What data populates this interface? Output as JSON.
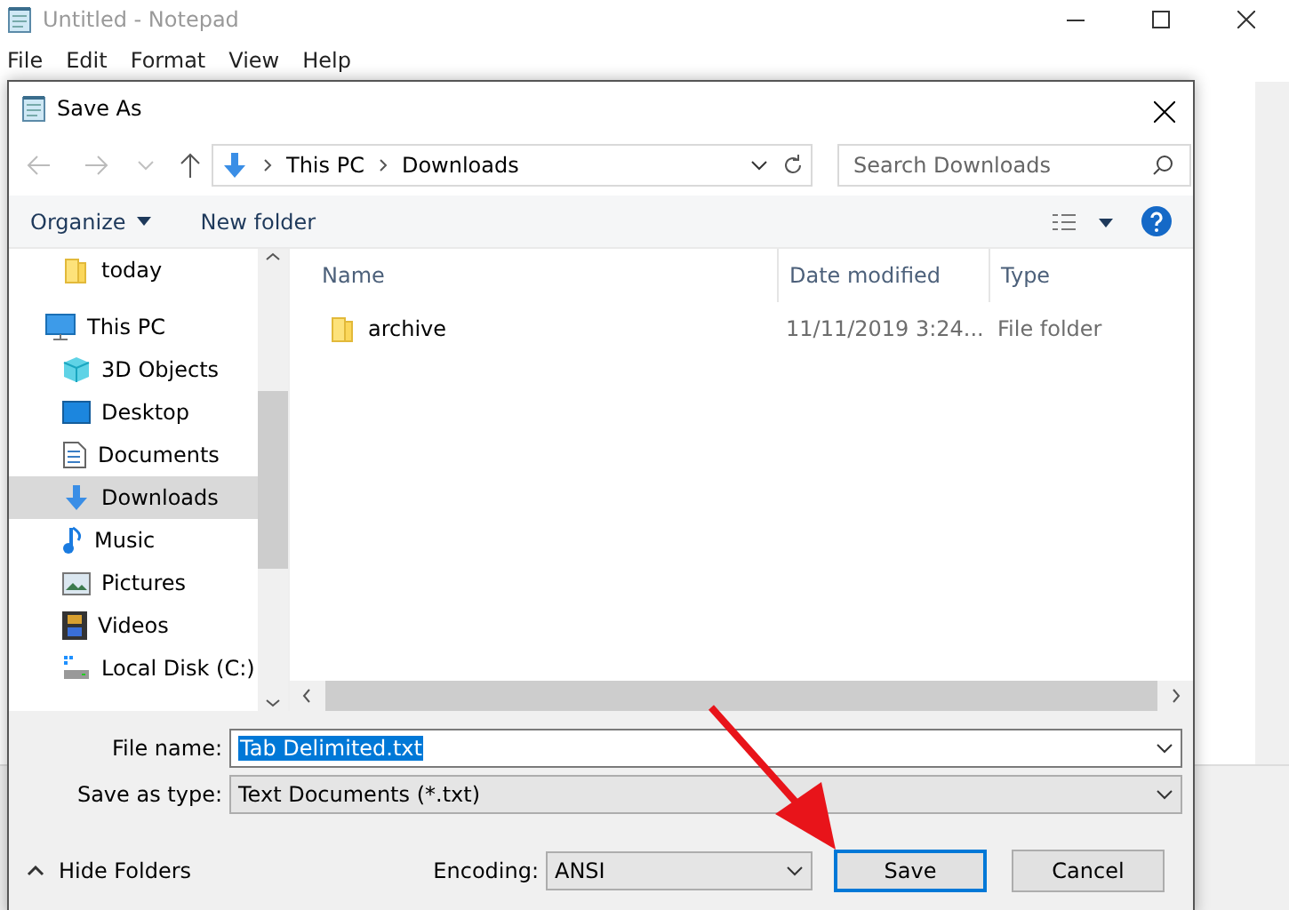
{
  "notepad": {
    "title": "Untitled - Notepad",
    "menu": [
      "File",
      "Edit",
      "Format",
      "View",
      "Help"
    ]
  },
  "dialog": {
    "title": "Save As",
    "breadcrumb": [
      "This PC",
      "Downloads"
    ],
    "search": {
      "placeholder": "Search Downloads"
    },
    "toolbar": {
      "organize": "Organize",
      "new_folder": "New folder"
    },
    "nav_items": [
      {
        "label": "today",
        "kind": "folder",
        "selected": false,
        "indented": true
      },
      {
        "label": "This PC",
        "kind": "pc",
        "selected": false,
        "indented": false
      },
      {
        "label": "3D Objects",
        "kind": "cube",
        "selected": false,
        "indented": true
      },
      {
        "label": "Desktop",
        "kind": "desktop",
        "selected": false,
        "indented": true
      },
      {
        "label": "Documents",
        "kind": "document",
        "selected": false,
        "indented": true
      },
      {
        "label": "Downloads",
        "kind": "download",
        "selected": true,
        "indented": true
      },
      {
        "label": "Music",
        "kind": "music",
        "selected": false,
        "indented": true
      },
      {
        "label": "Pictures",
        "kind": "pictures",
        "selected": false,
        "indented": true
      },
      {
        "label": "Videos",
        "kind": "videos",
        "selected": false,
        "indented": true
      },
      {
        "label": "Local Disk (C:)",
        "kind": "disk",
        "selected": false,
        "indented": true
      }
    ],
    "columns": [
      "Name",
      "Date modified",
      "Type"
    ],
    "rows": [
      {
        "name": "archive",
        "date": "11/11/2019 3:24...",
        "type": "File folder"
      }
    ],
    "file_name": {
      "label": "File name:",
      "value": "Tab Delimited.txt"
    },
    "save_type": {
      "label": "Save as type:",
      "value": "Text Documents (*.txt)"
    },
    "hide_folders": "Hide Folders",
    "encoding": {
      "label": "Encoding:",
      "value": "ANSI"
    },
    "buttons": [
      "Save",
      "Cancel"
    ]
  }
}
